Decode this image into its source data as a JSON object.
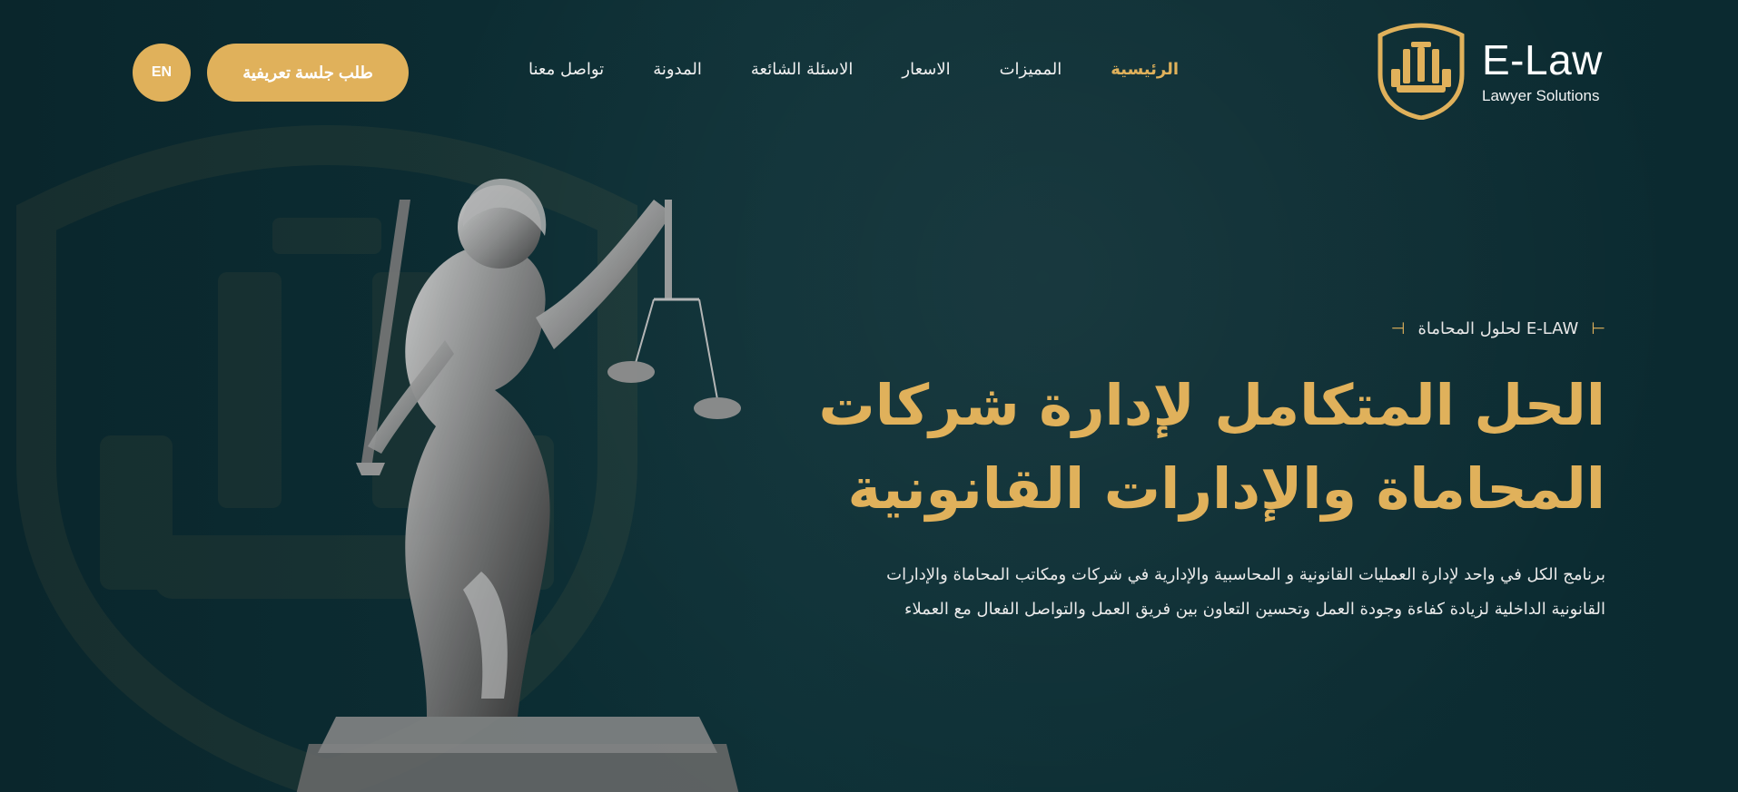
{
  "colors": {
    "background": "#0b2a30",
    "accent": "#e0b15b",
    "text": "#ffffff"
  },
  "topbar": {
    "lang_label": "EN",
    "cta_label": "طلب جلسة تعريفية",
    "nav": [
      {
        "label": "تواصل معنا",
        "active": false
      },
      {
        "label": "المدونة",
        "active": false
      },
      {
        "label": "الاسئلة الشائعة",
        "active": false
      },
      {
        "label": "الاسعار",
        "active": false
      },
      {
        "label": "المميزات",
        "active": false
      },
      {
        "label": "الرئيسية",
        "active": true
      }
    ],
    "brand": {
      "name": "E-Law",
      "subtitle": "Lawyer Solutions",
      "logo_icon": "scales-of-justice-icon"
    }
  },
  "hero": {
    "eyebrow": "E-LAW لحلول المحاماة",
    "headline_lines": [
      "الحل المتكامل لإدارة شركات",
      "المحاماة والإدارات القانونية"
    ],
    "description_lines": [
      "برنامج الكل في واحد لإدارة العمليات القانونية و المحاسبية والإدارية في شركات ومكاتب المحاماة والإدارات",
      "القانونية الداخلية لزيادة كفاءة وجودة العمل وتحسين التعاون بين فريق العمل والتواصل الفعال مع العملاء"
    ]
  },
  "imagery": {
    "hero_image": "statue-of-justice-icon",
    "background_mark": "shield-logo-watermark-icon"
  }
}
